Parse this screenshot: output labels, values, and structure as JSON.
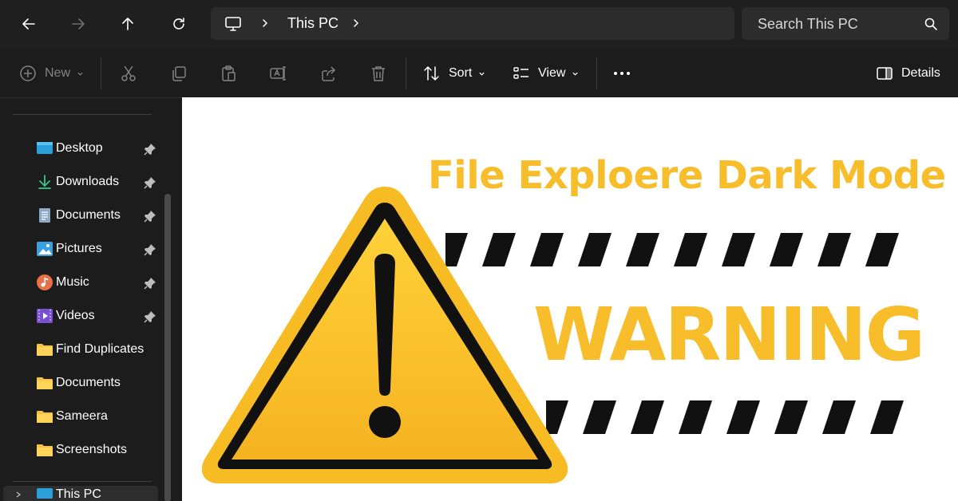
{
  "addressbar": {
    "breadcrumb": "This PC",
    "search_placeholder": "Search This PC"
  },
  "commandbar": {
    "new_label": "New",
    "sort_label": "Sort",
    "view_label": "View",
    "details_label": "Details"
  },
  "sidebar": {
    "items": [
      {
        "label": "Desktop",
        "icon": "desktop-icon",
        "pinned": true
      },
      {
        "label": "Downloads",
        "icon": "download-icon",
        "pinned": true
      },
      {
        "label": "Documents",
        "icon": "document-icon",
        "pinned": true
      },
      {
        "label": "Pictures",
        "icon": "pictures-icon",
        "pinned": true
      },
      {
        "label": "Music",
        "icon": "music-icon",
        "pinned": true
      },
      {
        "label": "Videos",
        "icon": "videos-icon",
        "pinned": true
      },
      {
        "label": "Find Duplicates",
        "icon": "folder-icon",
        "pinned": false
      },
      {
        "label": "Documents",
        "icon": "folder-icon",
        "pinned": false
      },
      {
        "label": "Sameera",
        "icon": "folder-icon",
        "pinned": false
      },
      {
        "label": "Screenshots",
        "icon": "folder-icon",
        "pinned": false
      }
    ],
    "this_pc_label": "This PC"
  },
  "content": {
    "headline": "File Exploere Dark Mode",
    "warning_text": "WARNING"
  },
  "colors": {
    "accent_yellow": "#f7bd2b",
    "dark_bg": "#1c1c1c"
  }
}
